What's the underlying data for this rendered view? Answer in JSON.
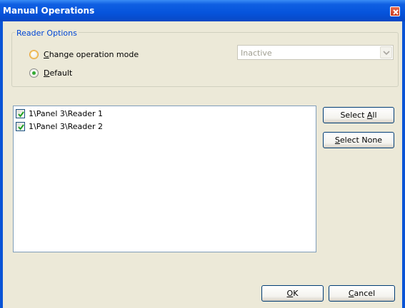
{
  "window": {
    "title": "Manual Operations"
  },
  "reader_options": {
    "legend": "Reader Options",
    "change_mode": {
      "label_accel": "C",
      "label_rest": "hange operation mode",
      "selected": false
    },
    "default": {
      "label_accel": "D",
      "label_rest": "efault",
      "selected": true
    },
    "mode_select": {
      "value": "Inactive",
      "disabled": true
    }
  },
  "readers": [
    {
      "label": "1\\Panel 3\\Reader 1",
      "checked": true
    },
    {
      "label": "1\\Panel 3\\Reader 2",
      "checked": true
    }
  ],
  "buttons": {
    "select_all": {
      "pre": "Select ",
      "accel": "A",
      "post": "ll"
    },
    "select_none": {
      "pre": "",
      "accel": "S",
      "post": "elect None"
    },
    "ok": {
      "pre": "",
      "accel": "O",
      "post": "K"
    },
    "cancel": {
      "pre": "",
      "accel": "C",
      "post": "ancel"
    }
  },
  "colors": {
    "title_bar": "#0654dc",
    "dialog_bg": "#ece9d8",
    "group_legend": "#0046d5",
    "check_mark": "#21a121",
    "radio_dot": "#33aa33"
  }
}
